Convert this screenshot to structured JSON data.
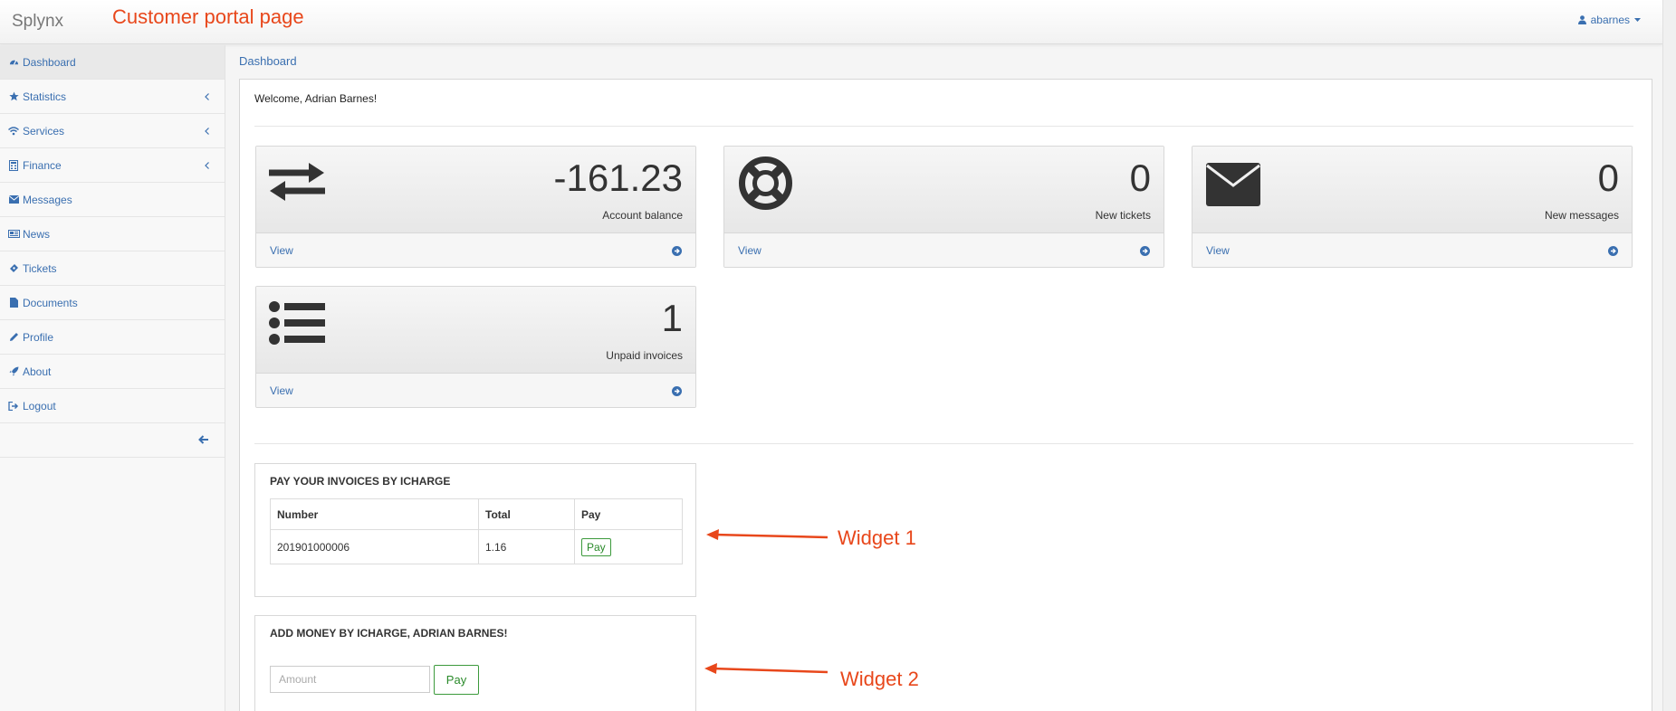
{
  "app": {
    "brand": "Splynx",
    "annotation_title": "Customer portal page",
    "user": "abarnes"
  },
  "sidebar": {
    "items": [
      {
        "label": "Dashboard",
        "icon": "dashboard-icon",
        "active": true,
        "submenu": false
      },
      {
        "label": "Statistics",
        "icon": "star-icon",
        "active": false,
        "submenu": true
      },
      {
        "label": "Services",
        "icon": "wifi-icon",
        "active": false,
        "submenu": true
      },
      {
        "label": "Finance",
        "icon": "calculator-icon",
        "active": false,
        "submenu": true
      },
      {
        "label": "Messages",
        "icon": "envelope-icon",
        "active": false,
        "submenu": false
      },
      {
        "label": "News",
        "icon": "newspaper-icon",
        "active": false,
        "submenu": false
      },
      {
        "label": "Tickets",
        "icon": "ticket-icon",
        "active": false,
        "submenu": false
      },
      {
        "label": "Documents",
        "icon": "file-icon",
        "active": false,
        "submenu": false
      },
      {
        "label": "Profile",
        "icon": "pencil-icon",
        "active": false,
        "submenu": false
      },
      {
        "label": "About",
        "icon": "rocket-icon",
        "active": false,
        "submenu": false
      },
      {
        "label": "Logout",
        "icon": "sign-out-icon",
        "active": false,
        "submenu": false
      }
    ]
  },
  "main": {
    "breadcrumb": "Dashboard",
    "welcome": "Welcome, Adrian Barnes!",
    "stats": [
      {
        "value": "-161.23",
        "label": "Account balance",
        "link": "View",
        "icon": "exchange-arrows-icon"
      },
      {
        "value": "0",
        "label": "New tickets",
        "link": "View",
        "icon": "life-ring-icon"
      },
      {
        "value": "0",
        "label": "New messages",
        "link": "View",
        "icon": "envelope-icon"
      },
      {
        "value": "1",
        "label": "Unpaid invoices",
        "link": "View",
        "icon": "list-icon"
      }
    ],
    "widget1": {
      "title": "PAY YOUR INVOICES BY ICHARGE",
      "columns": [
        "Number",
        "Total",
        "Pay"
      ],
      "rows": [
        {
          "number": "201901000006",
          "total": "1.16",
          "pay": "Pay"
        }
      ]
    },
    "widget2": {
      "title": "ADD MONEY BY ICHARGE, ADRIAN BARNES!",
      "amount_placeholder": "Amount",
      "pay_label": "Pay"
    }
  },
  "annotations": {
    "widget1": "Widget 1",
    "widget2": "Widget 2",
    "color": "#e8471b"
  },
  "colors": {
    "link": "#3a6fb0",
    "pay_button": "#2a8a2a"
  }
}
